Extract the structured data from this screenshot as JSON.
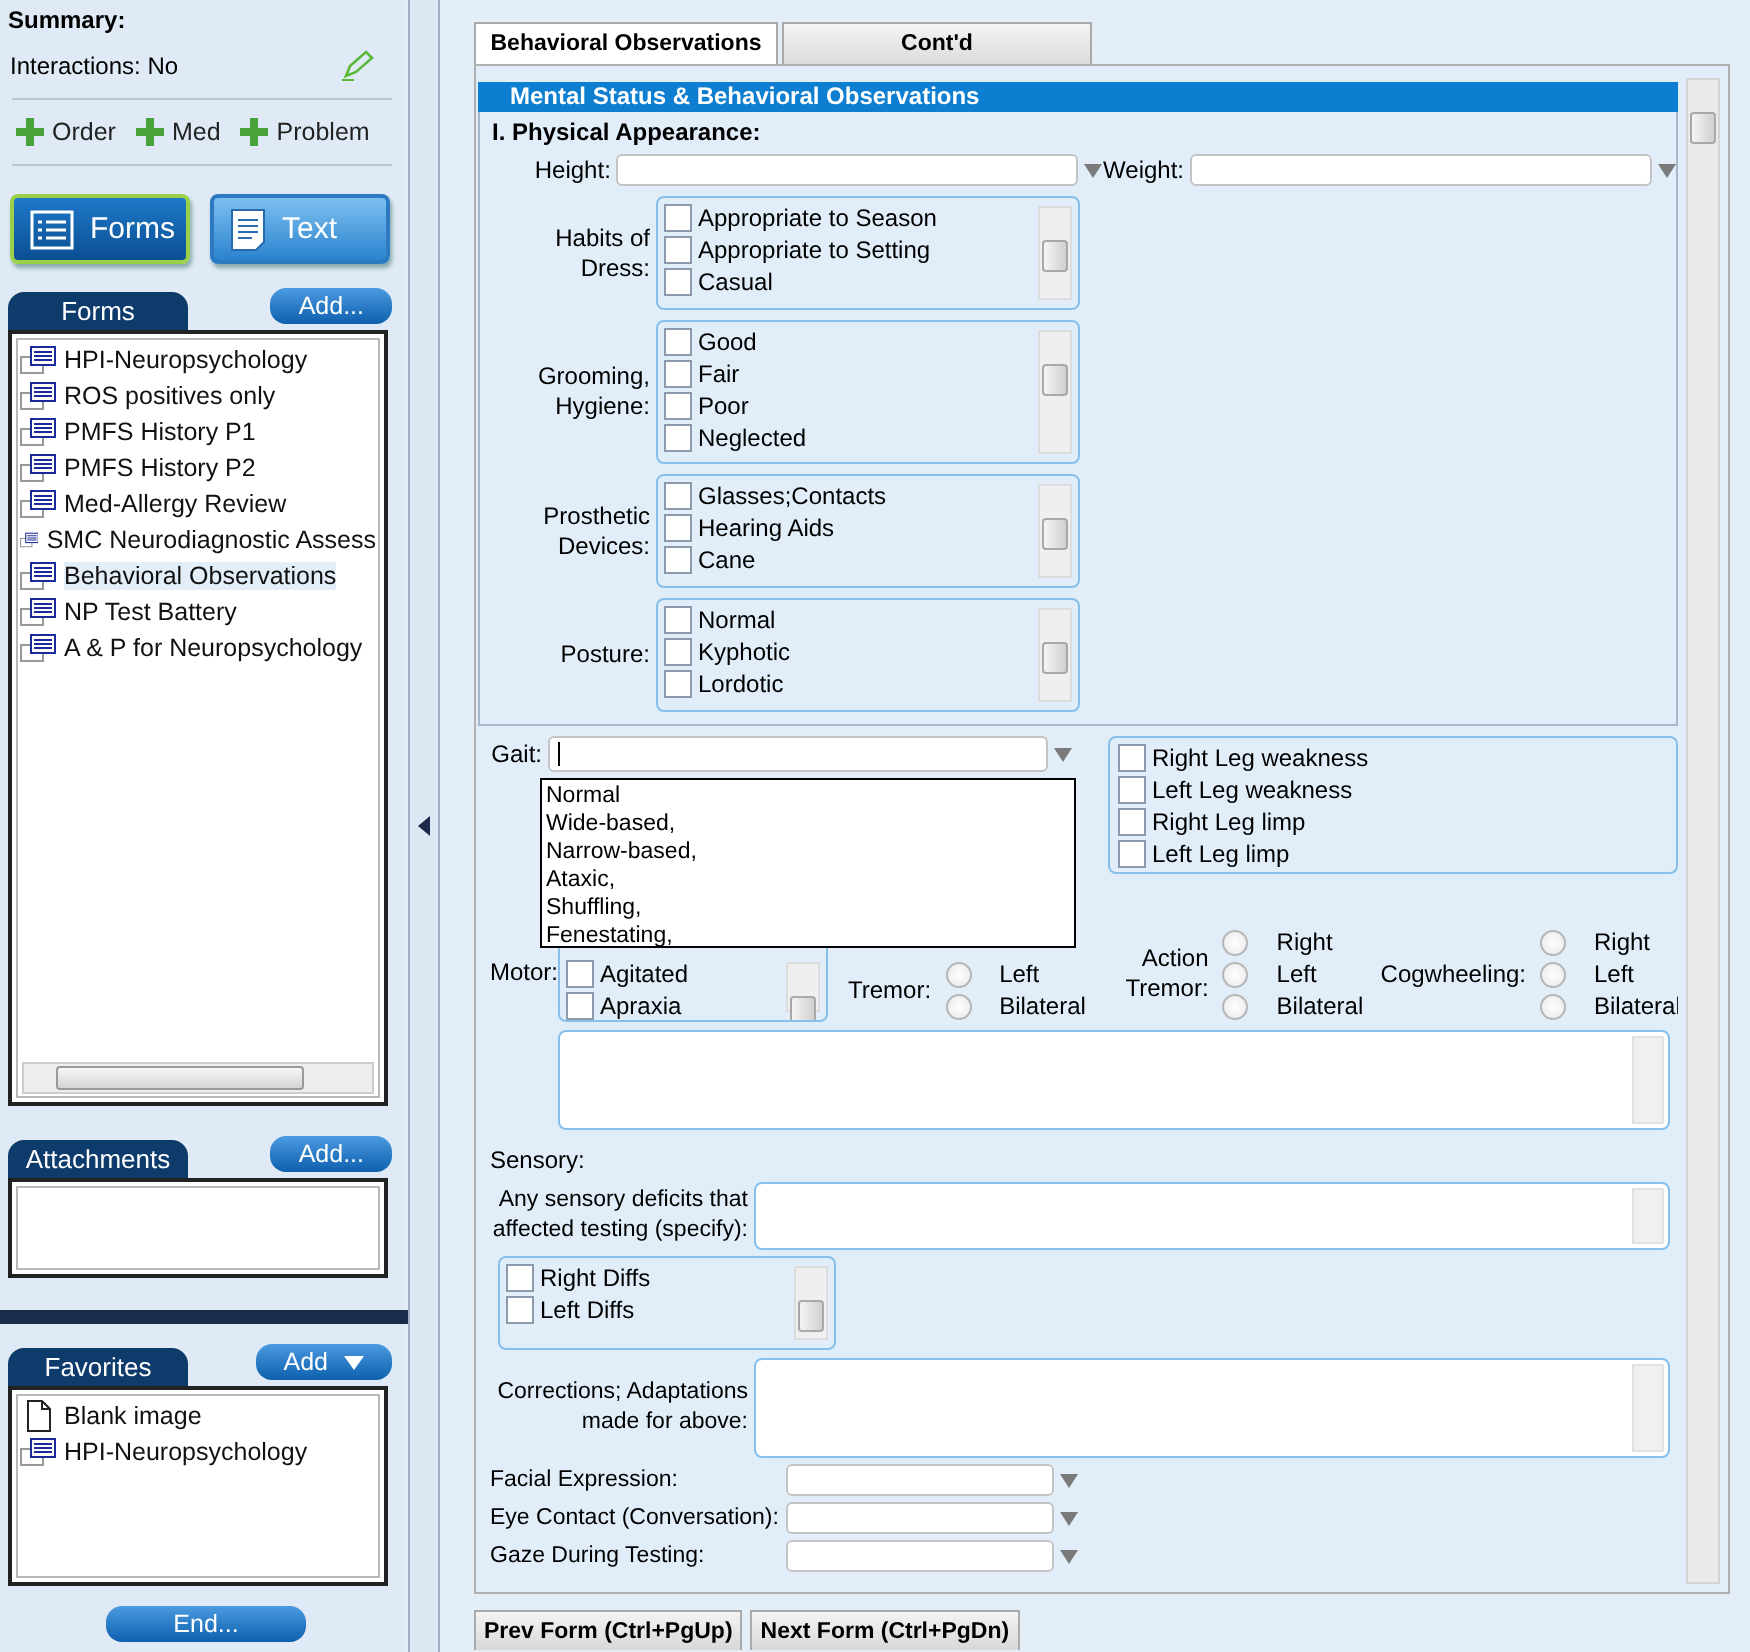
{
  "sidebar": {
    "summary_title": "Summary:",
    "interactions": "Interactions: No",
    "quick_add": [
      "Order",
      "Med",
      "Problem"
    ],
    "view_buttons": [
      {
        "label": "Forms",
        "kind": "forms",
        "selected": true
      },
      {
        "label": "Text",
        "kind": "text",
        "selected": false
      }
    ],
    "forms": {
      "tab": "Forms",
      "add_button": "Add...",
      "items": [
        {
          "label": "HPI-Neuropsychology",
          "selected": false
        },
        {
          "label": "ROS positives only",
          "selected": false
        },
        {
          "label": "PMFS History P1",
          "selected": false
        },
        {
          "label": "PMFS History P2",
          "selected": false
        },
        {
          "label": "Med-Allergy Review",
          "selected": false
        },
        {
          "label": "SMC Neurodiagnostic Assess",
          "selected": false
        },
        {
          "label": "Behavioral Observations",
          "selected": true
        },
        {
          "label": "NP Test Battery",
          "selected": false
        },
        {
          "label": "A & P for Neuropsychology",
          "selected": false
        }
      ]
    },
    "attachments": {
      "tab": "Attachments",
      "add_button": "Add..."
    },
    "favorites": {
      "tab": "Favorites",
      "add_button": "Add",
      "items": [
        {
          "label": "Blank image",
          "kind": "blank"
        },
        {
          "label": "HPI-Neuropsychology",
          "kind": "form"
        }
      ]
    },
    "end_button": "End..."
  },
  "tabs": [
    {
      "label": "Behavioral Observations",
      "selected": true
    },
    {
      "label": "Cont'd",
      "selected": false
    }
  ],
  "form": {
    "title": "Mental Status & Behavioral Observations",
    "physical_appearance": {
      "title": "I. Physical Appearance:",
      "rows": [
        {
          "kind": "dropdown_pair",
          "fields": [
            {
              "label": "Height:"
            },
            {
              "label": "Weight:"
            }
          ]
        },
        {
          "kind": "checklist",
          "label": "Habits of Dress:",
          "items": [
            {
              "label": "Appropriate to Season",
              "checked": false
            },
            {
              "label": "Appropriate to Setting",
              "checked": false
            },
            {
              "label": "Casual",
              "checked": false
            }
          ]
        },
        {
          "kind": "checklist",
          "label": "Grooming, Hygiene:",
          "items": [
            {
              "label": "Good",
              "checked": false
            },
            {
              "label": "Fair",
              "checked": false
            },
            {
              "label": "Poor",
              "checked": false
            },
            {
              "label": "Neglected",
              "checked": false
            }
          ]
        },
        {
          "kind": "checklist",
          "label": "Prosthetic Devices:",
          "items": [
            {
              "label": "Glasses;Contacts",
              "checked": false
            },
            {
              "label": "Hearing Aids",
              "checked": false
            },
            {
              "label": "Cane",
              "checked": false
            }
          ]
        },
        {
          "kind": "checklist",
          "label": "Posture:",
          "items": [
            {
              "label": "Normal",
              "checked": false
            },
            {
              "label": "Kyphotic",
              "checked": false
            },
            {
              "label": "Lordotic",
              "checked": false
            }
          ]
        }
      ]
    },
    "rows": [
      {
        "kind": "gait",
        "label": "Gait:",
        "options": [
          "Normal",
          "Wide-based,",
          "Narrow-based,",
          "Ataxic,",
          "Shuffling,",
          "Fenestating,"
        ],
        "items": [
          {
            "label": "Right Leg weakness",
            "checked": false
          },
          {
            "label": "Left Leg weakness",
            "checked": false
          },
          {
            "label": "Right Leg limp",
            "checked": false
          },
          {
            "label": "Left Leg limp",
            "checked": false
          }
        ]
      },
      {
        "kind": "motor",
        "label": "Motor:",
        "items": [
          {
            "label": "Agitated",
            "checked": false
          },
          {
            "label": "Apraxia",
            "checked": false
          }
        ],
        "tremors": [
          {
            "label": "Tremor:",
            "options": [
              {
                "label": "Left",
                "selected": false
              },
              {
                "label": "Bilateral",
                "selected": false
              }
            ]
          },
          {
            "label": "Action Tremor:",
            "options": [
              {
                "label": "Right",
                "selected": false
              },
              {
                "label": "Left",
                "selected": false
              },
              {
                "label": "Bilateral",
                "selected": false
              }
            ]
          },
          {
            "label": "Cogwheeling:",
            "options": [
              {
                "label": "Right",
                "selected": false
              },
              {
                "label": "Left",
                "selected": false
              },
              {
                "label": "Bilateral",
                "selected": false
              }
            ]
          }
        ]
      },
      {
        "kind": "textarea"
      },
      {
        "kind": "heading",
        "label": "Sensory:"
      },
      {
        "kind": "textarea_short",
        "label": "Any sensory deficits that affected testing (specify):"
      },
      {
        "kind": "checklist",
        "items": [
          {
            "label": "Right Diffs",
            "checked": false
          },
          {
            "label": "Left Diffs",
            "checked": false
          }
        ]
      },
      {
        "kind": "textarea",
        "label": "Corrections; Adaptations made for above:"
      },
      {
        "kind": "dropdown",
        "label": "Facial Expression:"
      },
      {
        "kind": "dropdown",
        "label": "Eye Contact (Conversation):"
      },
      {
        "kind": "dropdown",
        "label": "Gaze During Testing:"
      }
    ]
  },
  "buttons": [
    "Prev Form (Ctrl+PgUp)",
    "Next Form (Ctrl+PgDn)"
  ]
}
